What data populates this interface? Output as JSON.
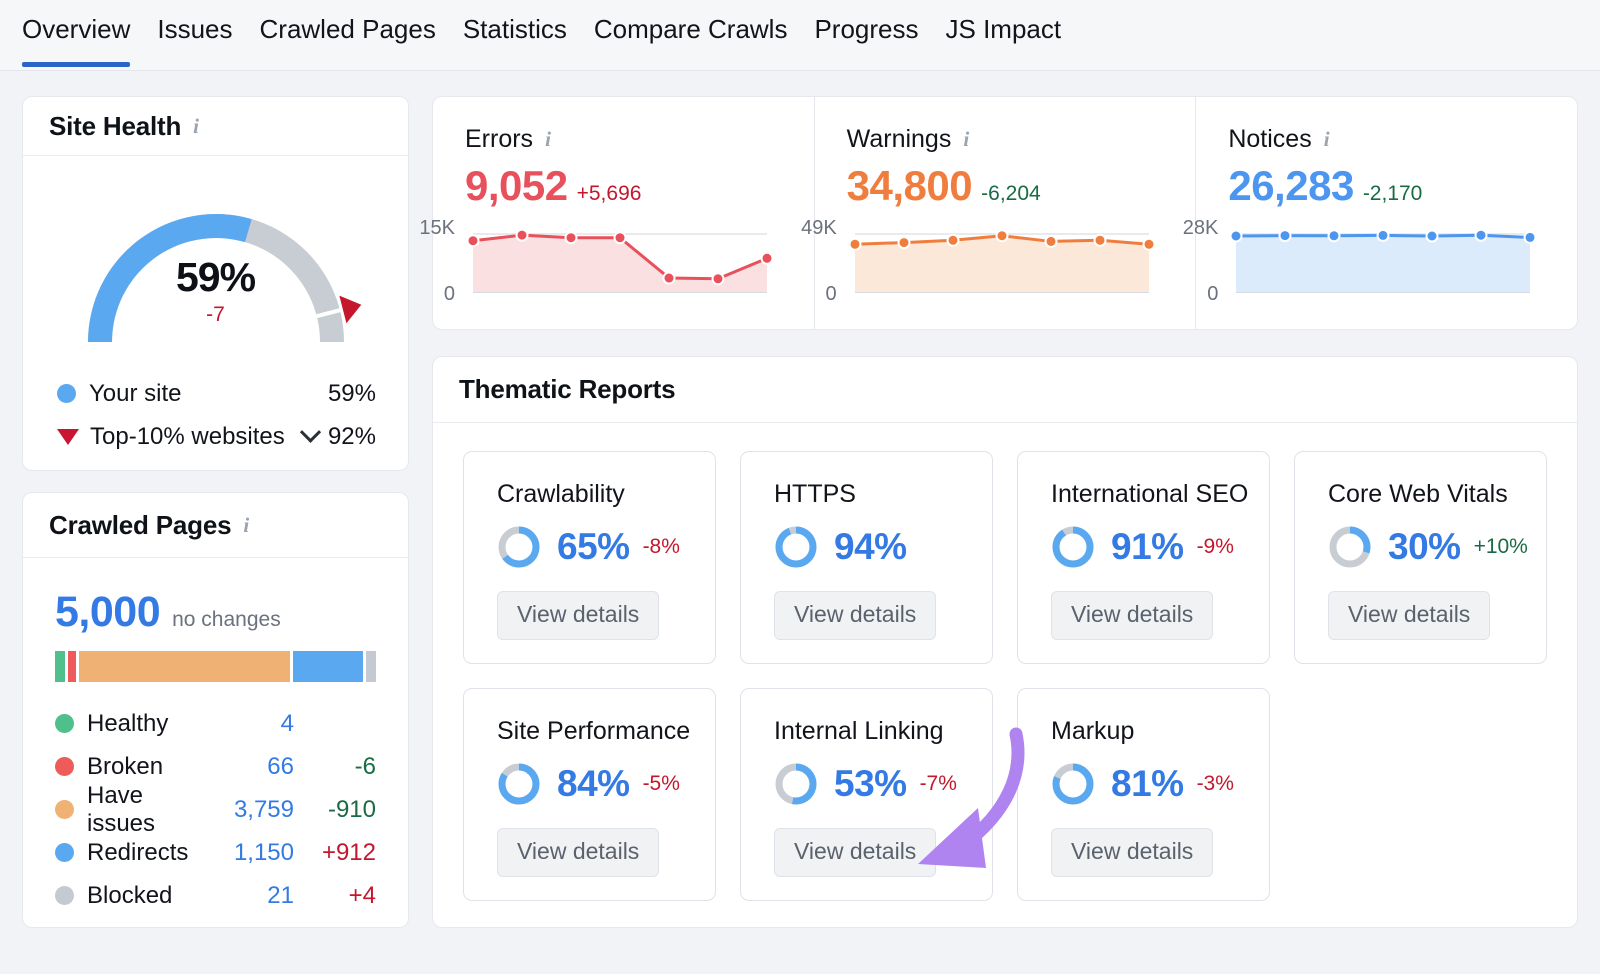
{
  "tabs": [
    {
      "label": "Overview",
      "active": true
    },
    {
      "label": "Issues",
      "active": false
    },
    {
      "label": "Crawled Pages",
      "active": false
    },
    {
      "label": "Statistics",
      "active": false
    },
    {
      "label": "Compare Crawls",
      "active": false
    },
    {
      "label": "Progress",
      "active": false
    },
    {
      "label": "JS Impact",
      "active": false
    }
  ],
  "site_health": {
    "title": "Site Health",
    "info_icon": "info-icon",
    "gauge_value": "59%",
    "gauge_delta": "-7",
    "legend": [
      {
        "label": "Your site",
        "value": "59%",
        "marker": "dot",
        "color": "#5aa9f0"
      },
      {
        "label": "Top-10% websites",
        "value": "92%",
        "marker": "triangle",
        "color": "#c91432",
        "has_dropdown": true
      }
    ]
  },
  "crawled_pages": {
    "title": "Crawled Pages",
    "info_icon": "info-icon",
    "total": "5,000",
    "total_note": "no changes",
    "rows": [
      {
        "label": "Healthy",
        "count": "4",
        "change": "",
        "dir": "none",
        "color": "#4fbf8b",
        "share": 3.2
      },
      {
        "label": "Broken",
        "count": "66",
        "change": "-6",
        "dir": "down",
        "color": "#ef5b5b",
        "share": 2.4
      },
      {
        "label": "Have issues",
        "count": "3,759",
        "change": "-910",
        "dir": "down",
        "color": "#f0b274",
        "share": 66.5
      },
      {
        "label": "Redirects",
        "count": "1,150",
        "change": "+912",
        "dir": "up",
        "color": "#5aa9f0",
        "share": 22.4
      },
      {
        "label": "Blocked",
        "count": "21",
        "change": "+4",
        "dir": "up",
        "color": "#c5cad2",
        "share": 3.0
      }
    ]
  },
  "kpis": [
    {
      "label": "Errors",
      "value": "9,052",
      "diff": "+5,696",
      "diff_dir": "up",
      "color": "#e8505b",
      "fill": "#fbe0e2",
      "axis_top": "15K",
      "axis_bottom": "0"
    },
    {
      "label": "Warnings",
      "value": "34,800",
      "diff": "-6,204",
      "diff_dir": "down",
      "color": "#ef7e3e",
      "fill": "#fce8d8",
      "axis_top": "49K",
      "axis_bottom": "0"
    },
    {
      "label": "Notices",
      "value": "26,283",
      "diff": "-2,170",
      "diff_dir": "down",
      "color": "#4d96ef",
      "fill": "#dcebfb",
      "axis_top": "28K",
      "axis_bottom": "0"
    }
  ],
  "thematic": {
    "title": "Thematic Reports",
    "button_label": "View details",
    "cards": [
      {
        "name": "Crawlability",
        "pct": "65%",
        "pct_value": 65,
        "delta": "-8%",
        "dir": "up"
      },
      {
        "name": "HTTPS",
        "pct": "94%",
        "pct_value": 94,
        "delta": "",
        "dir": "none"
      },
      {
        "name": "International SEO",
        "pct": "91%",
        "pct_value": 91,
        "delta": "-9%",
        "dir": "up"
      },
      {
        "name": "Core Web Vitals",
        "pct": "30%",
        "pct_value": 30,
        "delta": "+10%",
        "dir": "down"
      },
      {
        "name": "Site Performance",
        "pct": "84%",
        "pct_value": 84,
        "delta": "-5%",
        "dir": "up"
      },
      {
        "name": "Internal Linking",
        "pct": "53%",
        "pct_value": 53,
        "delta": "-7%",
        "dir": "up"
      },
      {
        "name": "Markup",
        "pct": "81%",
        "pct_value": 81,
        "delta": "-3%",
        "dir": "up"
      }
    ]
  },
  "annotation": {
    "arrow_color": "#b084f0",
    "points_at": "View details"
  },
  "chart_data": [
    {
      "type": "line",
      "title": "Errors",
      "ylabel": "",
      "xlabel": "",
      "ylim": [
        0,
        15000
      ],
      "tick_labels": [
        "0",
        "15K"
      ],
      "series": [
        {
          "name": "Errors",
          "values": [
            13200,
            14700,
            14000,
            14000,
            3200,
            3000,
            8500
          ]
        }
      ],
      "grid": true,
      "legend": "none",
      "color": "#e8505b"
    },
    {
      "type": "line",
      "title": "Warnings",
      "ylabel": "",
      "xlabel": "",
      "ylim": [
        0,
        49000
      ],
      "tick_labels": [
        "0",
        "49K"
      ],
      "series": [
        {
          "name": "Warnings",
          "values": [
            40000,
            41500,
            43500,
            47500,
            42500,
            43500,
            40000
          ]
        }
      ],
      "grid": true,
      "legend": "none",
      "color": "#ef7e3e"
    },
    {
      "type": "line",
      "title": "Notices",
      "ylabel": "",
      "xlabel": "",
      "ylim": [
        0,
        28000
      ],
      "tick_labels": [
        "0",
        "28K"
      ],
      "series": [
        {
          "name": "Notices",
          "values": [
            27000,
            27200,
            27100,
            27300,
            27000,
            27400,
            26283
          ]
        }
      ],
      "grid": true,
      "legend": "none",
      "color": "#4d96ef"
    },
    {
      "type": "pie",
      "title": "Site Health",
      "labels": [
        "Your site",
        "Remaining"
      ],
      "values": [
        59,
        41
      ],
      "benchmark_label": "Top-10% websites",
      "benchmark_value": 92
    },
    {
      "type": "bar",
      "title": "Crawled Pages",
      "categories": [
        "Healthy",
        "Broken",
        "Have issues",
        "Redirects",
        "Blocked"
      ],
      "values": [
        4,
        66,
        3759,
        1150,
        21
      ],
      "total": 5000
    }
  ]
}
